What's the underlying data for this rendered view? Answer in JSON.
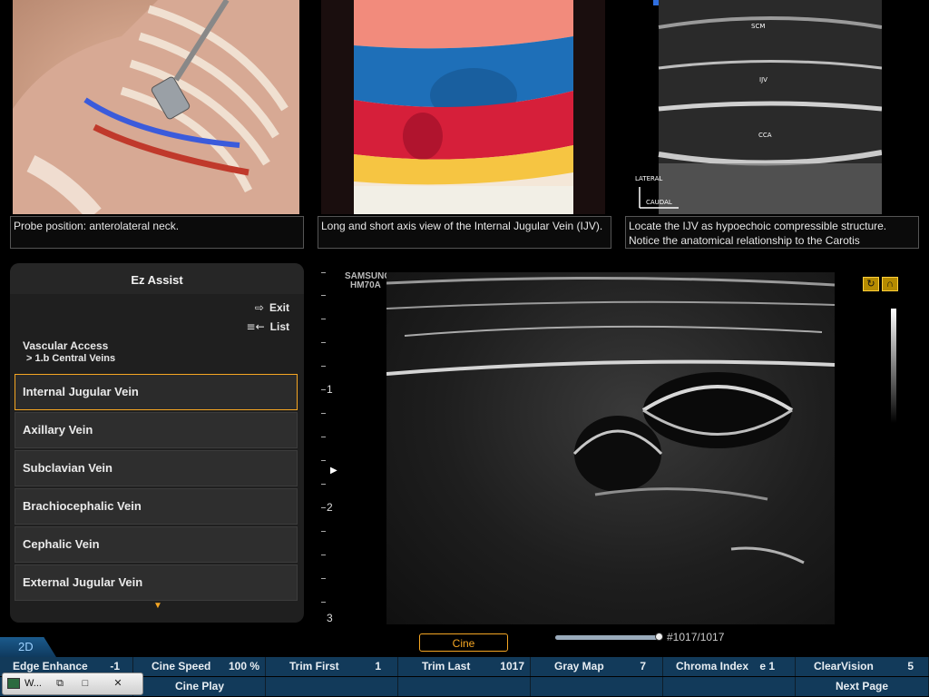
{
  "reference_panels": [
    {
      "caption": "Probe position: anterolateral neck."
    },
    {
      "caption": "Long and short axis view of the Internal Jugular Vein (IJV)."
    },
    {
      "caption": "Locate the IJV as hypoechoic compressible structure. Notice the anatomical relationship to the Carotis"
    }
  ],
  "us_ref_labels": {
    "scm": "SCM",
    "ijv": "IJV",
    "cca": "CCA",
    "lateral": "LATERAL",
    "caudal": "CAUDAL"
  },
  "ez_assist": {
    "title": "Ez Assist",
    "exit_label": "Exit",
    "list_label": "List",
    "exit_icon": "exit-icon",
    "list_icon": "list-icon",
    "category": "Vascular Access",
    "subcategory": "> 1.b Central Veins",
    "items": [
      {
        "label": "Internal Jugular Vein",
        "selected": true
      },
      {
        "label": "Axillary Vein"
      },
      {
        "label": "Subclavian Vein"
      },
      {
        "label": "Brachiocephalic Vein"
      },
      {
        "label": "Cephalic Vein"
      },
      {
        "label": "External Jugular Vein"
      }
    ],
    "more_icon": "chevron-down-icon"
  },
  "scan": {
    "brand": "SAMSUNG",
    "probe": "HM70A",
    "depth_marks": [
      "1",
      "2",
      "3"
    ]
  },
  "bottom": {
    "mode_tab": "2D",
    "cine_button": "Cine",
    "frame_readout": "#1017/1017",
    "frame_progress": 1.0,
    "row1": [
      {
        "label": "Edge Enhance",
        "value": "-1"
      },
      {
        "label": "Cine Speed",
        "value": "100 %"
      },
      {
        "label": "Trim First",
        "value": "1"
      },
      {
        "label": "Trim Last",
        "value": "1017"
      },
      {
        "label": "Gray Map",
        "value": "7"
      },
      {
        "label": "Chroma Index",
        "value": "e 1"
      },
      {
        "label": "ClearVision",
        "value": "5"
      }
    ],
    "row2": [
      {
        "label": ""
      },
      {
        "label": "Cine Play"
      },
      {
        "label": ""
      },
      {
        "label": ""
      },
      {
        "label": ""
      },
      {
        "label": ""
      },
      {
        "label": "Next Page"
      }
    ]
  },
  "taskbar": {
    "title": "W...",
    "buttons": [
      "restore-icon",
      "maximize-icon",
      "close-icon"
    ]
  },
  "colors": {
    "accent": "#f5a623",
    "param_bar": "#123a5a",
    "mode_tab": "#1b5a8c"
  }
}
